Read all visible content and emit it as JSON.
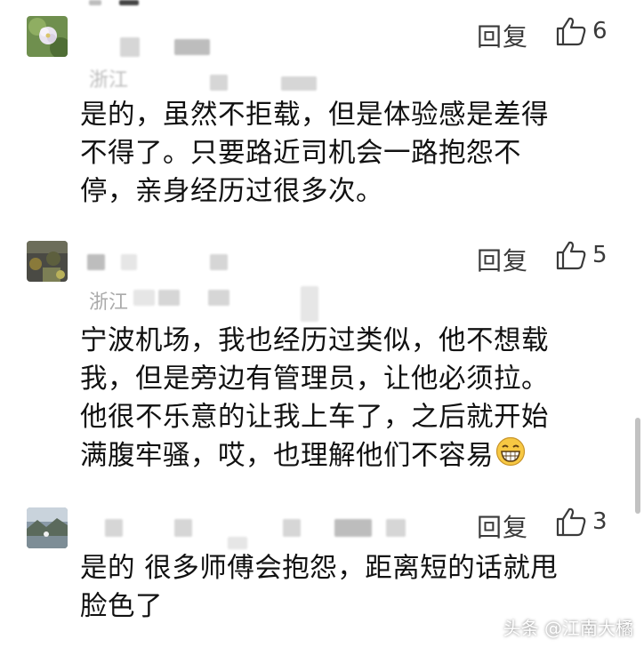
{
  "comments": [
    {
      "reply_label": "回复",
      "likes": "6",
      "location": "浙江",
      "text": "是的，虽然不拒载，但是体验感是差得\n不得了。只要路近司机会一路抱怨不\n停，亲身经历过很多次。",
      "avatar_icon": "flower-avatar-icon"
    },
    {
      "reply_label": "回复",
      "likes": "5",
      "location": "浙江",
      "text": "宁波机场，我也经历过类似，他不想载\n我，但是旁边有管理员，让他必须拉。\n他很不乐意的让我上车了，之后就开始\n满腹牢骚，哎，也理解他们不容易",
      "avatar_icon": "photo-avatar-icon",
      "emoji_icon": "grinning-emoji-icon"
    },
    {
      "reply_label": "回复",
      "likes": "3",
      "text": "是的 很多师傅会抱怨，距离短的话就甩\n脸色了",
      "avatar_icon": "landscape-avatar-icon"
    }
  ],
  "watermark": "头条 @江南大橘",
  "colors": {
    "text": "#111111",
    "muted": "#3a3a3a",
    "location": "#999999"
  }
}
